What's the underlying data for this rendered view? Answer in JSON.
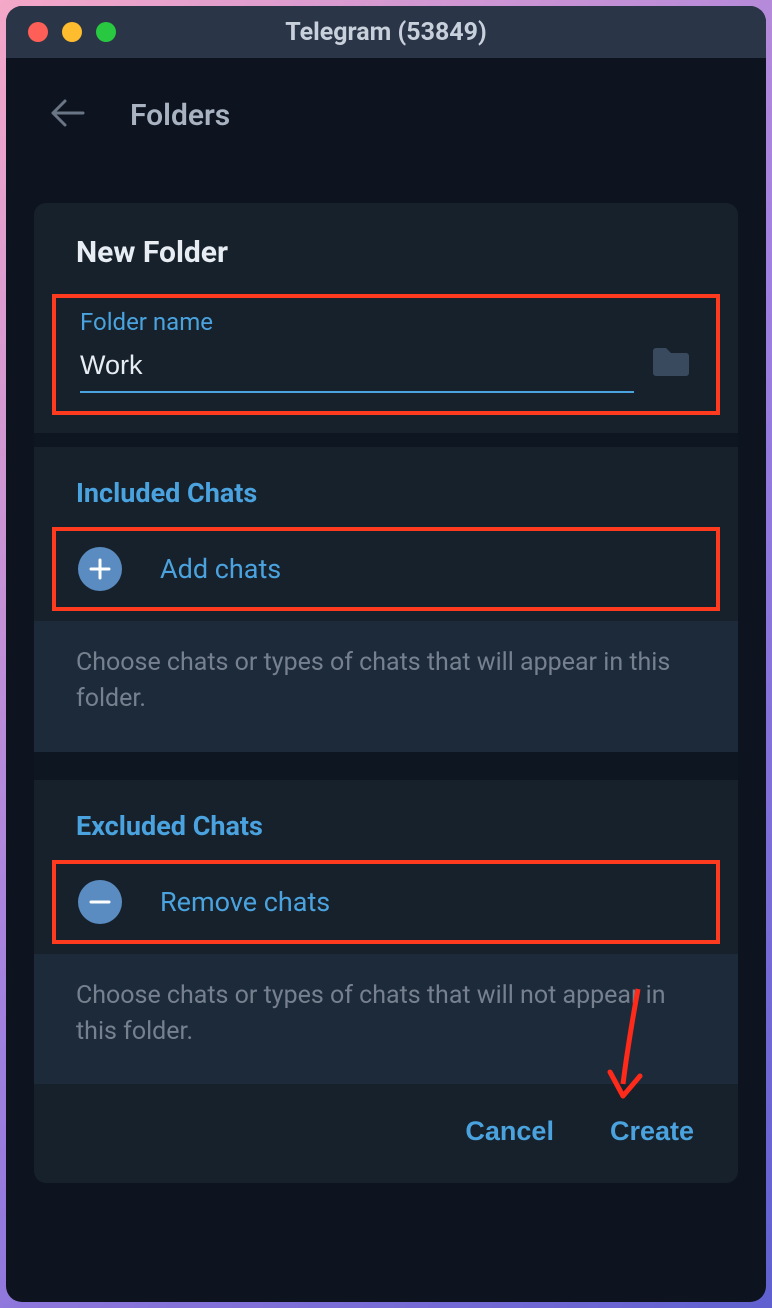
{
  "titlebar": {
    "title": "Telegram (53849)"
  },
  "header": {
    "title": "Folders"
  },
  "newFolder": {
    "title": "New Folder",
    "fieldLabel": "Folder name",
    "fieldValue": "Work"
  },
  "included": {
    "title": "Included Chats",
    "actionLabel": "Add chats",
    "description": "Choose chats or types of chats that will appear in this folder."
  },
  "excluded": {
    "title": "Excluded Chats",
    "actionLabel": "Remove chats",
    "description": "Choose chats or types of chats that will not appear in this folder."
  },
  "footer": {
    "cancel": "Cancel",
    "create": "Create"
  }
}
